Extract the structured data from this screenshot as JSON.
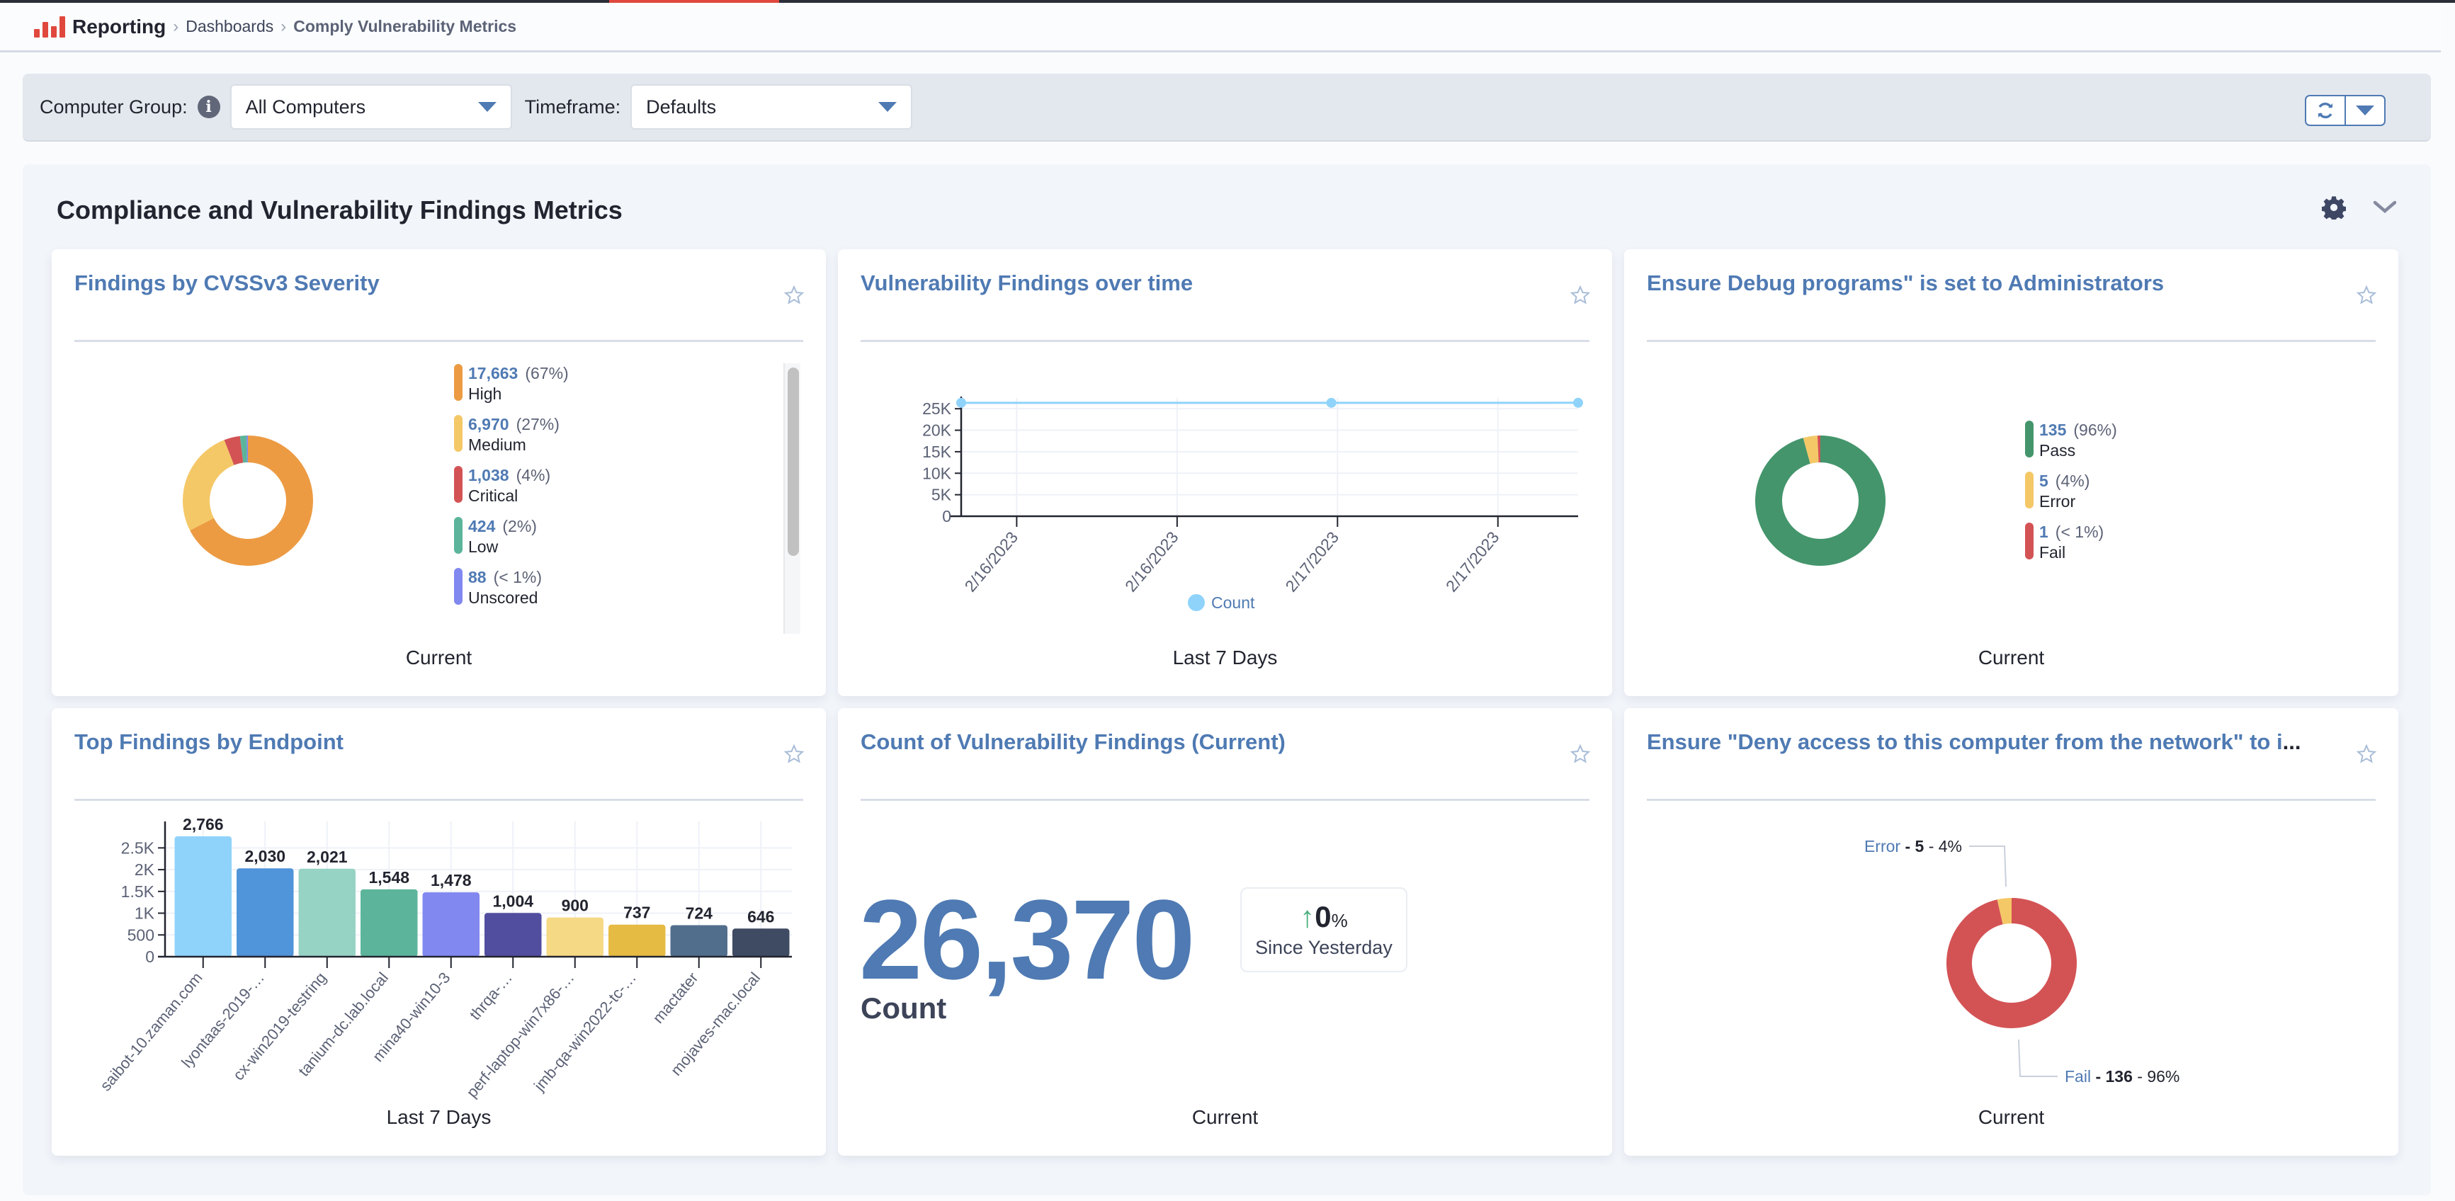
{
  "header": {
    "app": "Reporting",
    "breadcrumbs": [
      "Dashboards",
      "Comply Vulnerability Metrics"
    ]
  },
  "filters": {
    "computer_group_label": "Computer Group:",
    "computer_group_value": "All Computers",
    "timeframe_label": "Timeframe:",
    "timeframe_value": "Defaults"
  },
  "section": {
    "title": "Compliance and Vulnerability Findings Metrics"
  },
  "colors": {
    "accent": "#4f7ab3",
    "brand_red": "#e0483d"
  },
  "cards": {
    "severity": {
      "title": "Findings by CVSSv3 Severity",
      "footer": "Current",
      "legend": [
        {
          "value": "17,663",
          "pct": "(67%)",
          "label": "High",
          "color": "#ec9b43"
        },
        {
          "value": "6,970",
          "pct": "(27%)",
          "label": "Medium",
          "color": "#f4c867"
        },
        {
          "value": "1,038",
          "pct": "(4%)",
          "label": "Critical",
          "color": "#d35355"
        },
        {
          "value": "424",
          "pct": "(2%)",
          "label": "Low",
          "color": "#5cb59b"
        },
        {
          "value": "88",
          "pct": "(< 1%)",
          "label": "Unscored",
          "color": "#8188f0"
        }
      ]
    },
    "over_time": {
      "title": "Vulnerability Findings over time",
      "footer": "Last 7 Days",
      "legend_label": "Count"
    },
    "debug": {
      "title": "Ensure Debug programs\" is set to Administrators",
      "footer": "Current",
      "legend": [
        {
          "value": "135",
          "pct": "(96%)",
          "label": "Pass",
          "color": "#44956c"
        },
        {
          "value": "5",
          "pct": "(4%)",
          "label": "Error",
          "color": "#f4c867"
        },
        {
          "value": "1",
          "pct": "(< 1%)",
          "label": "Fail",
          "color": "#d35355"
        }
      ]
    },
    "endpoints": {
      "title": "Top Findings by Endpoint",
      "footer": "Last 7 Days"
    },
    "count": {
      "title": "Count of Vulnerability Findings (Current)",
      "value": "26,370",
      "label": "Count",
      "delta_value": "0",
      "delta_unit": "%",
      "delta_label": "Since Yesterday",
      "footer": "Current"
    },
    "deny": {
      "title": "Ensure \"Deny access to this computer from the network\" to i",
      "title_ellipsis": "...",
      "footer": "Current",
      "labels": [
        {
          "name": "Error",
          "value": "5",
          "pct": "4%"
        },
        {
          "name": "Fail",
          "value": "136",
          "pct": "96%"
        }
      ]
    }
  },
  "chart_data": [
    {
      "type": "pie",
      "title": "Findings by CVSSv3 Severity",
      "donut": true,
      "categories": [
        "High",
        "Medium",
        "Critical",
        "Low",
        "Unscored"
      ],
      "values": [
        17663,
        6970,
        1038,
        424,
        88
      ],
      "colors": [
        "#ec9b43",
        "#f4c867",
        "#d35355",
        "#5cb59b",
        "#8188f0"
      ],
      "legend": "right"
    },
    {
      "type": "line",
      "title": "Vulnerability Findings over time",
      "series": [
        {
          "name": "Count",
          "color": "#8fd3fb",
          "values": [
            26370,
            26370,
            26380
          ]
        }
      ],
      "x_fraction": [
        0,
        0.6,
        1.0
      ],
      "xtick_labels": [
        "2/16/2023",
        "2/16/2023",
        "2/17/2023",
        "2/17/2023"
      ],
      "ytick_labels": [
        "0",
        "5K",
        "10K",
        "15K",
        "20K",
        "25K"
      ],
      "yticks": [
        0,
        5000,
        10000,
        15000,
        20000,
        25000
      ],
      "ylim": [
        0,
        27500
      ],
      "grid": true,
      "legend": "bottom"
    },
    {
      "type": "pie",
      "title": "Ensure Debug programs\" is set to Administrators",
      "donut": true,
      "categories": [
        "Pass",
        "Error",
        "Fail"
      ],
      "values": [
        135,
        5,
        1
      ],
      "colors": [
        "#44956c",
        "#f4c867",
        "#d35355"
      ],
      "legend": "right"
    },
    {
      "type": "bar",
      "title": "Top Findings by Endpoint",
      "categories": [
        "saibot-10.zaman.com",
        "lyontaas-2019-…",
        "cx-win2019-testring",
        "tanium-dc.lab.local",
        "mina40-win10-3",
        "thrqa-…",
        "perf-laptop-win7x86-…",
        "jmb-qa-win2022-tc-…",
        "mactater",
        "mojaves-mac.local"
      ],
      "values": [
        2766,
        2030,
        2021,
        1548,
        1478,
        1004,
        900,
        737,
        724,
        646
      ],
      "data_labels": [
        "2,766",
        "2,030",
        "2,021",
        "1,548",
        "1,478",
        "1,004",
        "900",
        "737",
        "724",
        "646"
      ],
      "colors": [
        "#8fd3fb",
        "#5094d9",
        "#97d3c5",
        "#5cb59b",
        "#8188f0",
        "#514ea0",
        "#f5d985",
        "#e6bb44",
        "#526e8d",
        "#3e4b62"
      ],
      "ytick_labels": [
        "0",
        "500",
        "1K",
        "1.5K",
        "2K",
        "2.5K"
      ],
      "yticks": [
        0,
        500,
        1000,
        1500,
        2000,
        2500
      ],
      "ylim": [
        0,
        2766
      ],
      "grid": true
    },
    {
      "type": "pie",
      "title": "Ensure \"Deny access to this computer from the network\" to i...",
      "donut": true,
      "categories": [
        "Fail",
        "Error"
      ],
      "values": [
        136,
        5
      ],
      "colors": [
        "#d35355",
        "#f4c867"
      ],
      "legend": "callout labels"
    }
  ]
}
